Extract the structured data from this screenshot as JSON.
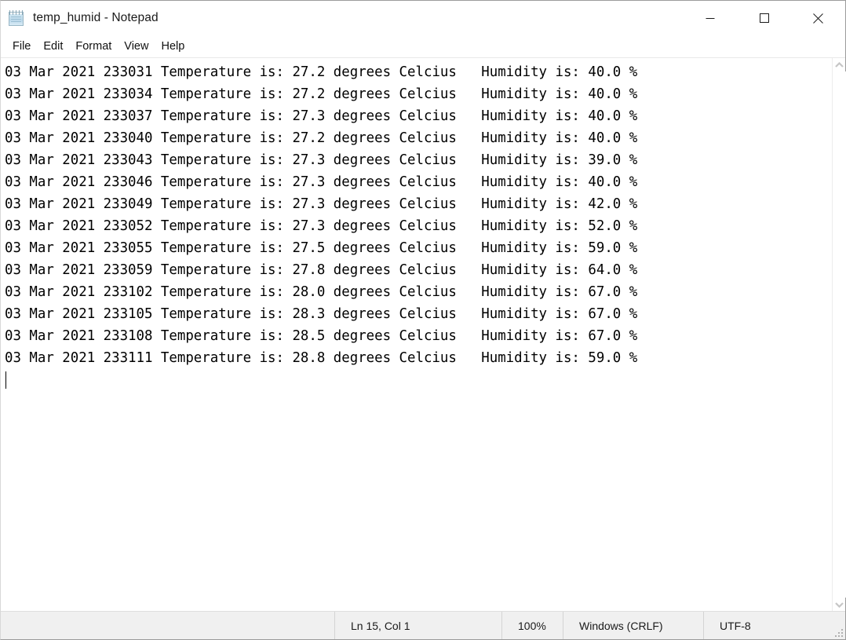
{
  "window": {
    "title": "temp_humid - Notepad",
    "icon": "notepad-icon",
    "controls": {
      "minimize": "—",
      "maximize": "□",
      "close": "✕"
    }
  },
  "menubar": {
    "items": [
      {
        "label": "File"
      },
      {
        "label": "Edit"
      },
      {
        "label": "Format"
      },
      {
        "label": "View"
      },
      {
        "label": "Help"
      }
    ]
  },
  "editor": {
    "lines": [
      "03 Mar 2021 233031 Temperature is: 27.2 degrees Celcius   Humidity is: 40.0 %",
      "03 Mar 2021 233034 Temperature is: 27.2 degrees Celcius   Humidity is: 40.0 %",
      "03 Mar 2021 233037 Temperature is: 27.3 degrees Celcius   Humidity is: 40.0 %",
      "03 Mar 2021 233040 Temperature is: 27.2 degrees Celcius   Humidity is: 40.0 %",
      "03 Mar 2021 233043 Temperature is: 27.3 degrees Celcius   Humidity is: 39.0 %",
      "03 Mar 2021 233046 Temperature is: 27.3 degrees Celcius   Humidity is: 40.0 %",
      "03 Mar 2021 233049 Temperature is: 27.3 degrees Celcius   Humidity is: 42.0 %",
      "03 Mar 2021 233052 Temperature is: 27.3 degrees Celcius   Humidity is: 52.0 %",
      "03 Mar 2021 233055 Temperature is: 27.5 degrees Celcius   Humidity is: 59.0 %",
      "03 Mar 2021 233059 Temperature is: 27.8 degrees Celcius   Humidity is: 64.0 %",
      "03 Mar 2021 233102 Temperature is: 28.0 degrees Celcius   Humidity is: 67.0 %",
      "03 Mar 2021 233105 Temperature is: 28.3 degrees Celcius   Humidity is: 67.0 %",
      "03 Mar 2021 233108 Temperature is: 28.5 degrees Celcius   Humidity is: 67.0 %",
      "03 Mar 2021 233111 Temperature is: 28.8 degrees Celcius   Humidity is: 59.0 %"
    ],
    "records": [
      {
        "day": "03",
        "month": "Mar",
        "year": "2021",
        "time": "233031",
        "temperature_c": 27.2,
        "humidity_pct": 40.0
      },
      {
        "day": "03",
        "month": "Mar",
        "year": "2021",
        "time": "233034",
        "temperature_c": 27.2,
        "humidity_pct": 40.0
      },
      {
        "day": "03",
        "month": "Mar",
        "year": "2021",
        "time": "233037",
        "temperature_c": 27.3,
        "humidity_pct": 40.0
      },
      {
        "day": "03",
        "month": "Mar",
        "year": "2021",
        "time": "233040",
        "temperature_c": 27.2,
        "humidity_pct": 40.0
      },
      {
        "day": "03",
        "month": "Mar",
        "year": "2021",
        "time": "233043",
        "temperature_c": 27.3,
        "humidity_pct": 39.0
      },
      {
        "day": "03",
        "month": "Mar",
        "year": "2021",
        "time": "233046",
        "temperature_c": 27.3,
        "humidity_pct": 40.0
      },
      {
        "day": "03",
        "month": "Mar",
        "year": "2021",
        "time": "233049",
        "temperature_c": 27.3,
        "humidity_pct": 42.0
      },
      {
        "day": "03",
        "month": "Mar",
        "year": "2021",
        "time": "233052",
        "temperature_c": 27.3,
        "humidity_pct": 52.0
      },
      {
        "day": "03",
        "month": "Mar",
        "year": "2021",
        "time": "233055",
        "temperature_c": 27.5,
        "humidity_pct": 59.0
      },
      {
        "day": "03",
        "month": "Mar",
        "year": "2021",
        "time": "233059",
        "temperature_c": 27.8,
        "humidity_pct": 64.0
      },
      {
        "day": "03",
        "month": "Mar",
        "year": "2021",
        "time": "233102",
        "temperature_c": 28.0,
        "humidity_pct": 67.0
      },
      {
        "day": "03",
        "month": "Mar",
        "year": "2021",
        "time": "233105",
        "temperature_c": 28.3,
        "humidity_pct": 67.0
      },
      {
        "day": "03",
        "month": "Mar",
        "year": "2021",
        "time": "233108",
        "temperature_c": 28.5,
        "humidity_pct": 67.0
      },
      {
        "day": "03",
        "month": "Mar",
        "year": "2021",
        "time": "233111",
        "temperature_c": 28.8,
        "humidity_pct": 59.0
      }
    ]
  },
  "scrollbar": {
    "up_arrow": "scroll-up-icon",
    "down_arrow": "scroll-down-icon"
  },
  "statusbar": {
    "position": "Ln 15, Col 1",
    "zoom": "100%",
    "line_ending": "Windows (CRLF)",
    "encoding": "UTF-8"
  }
}
